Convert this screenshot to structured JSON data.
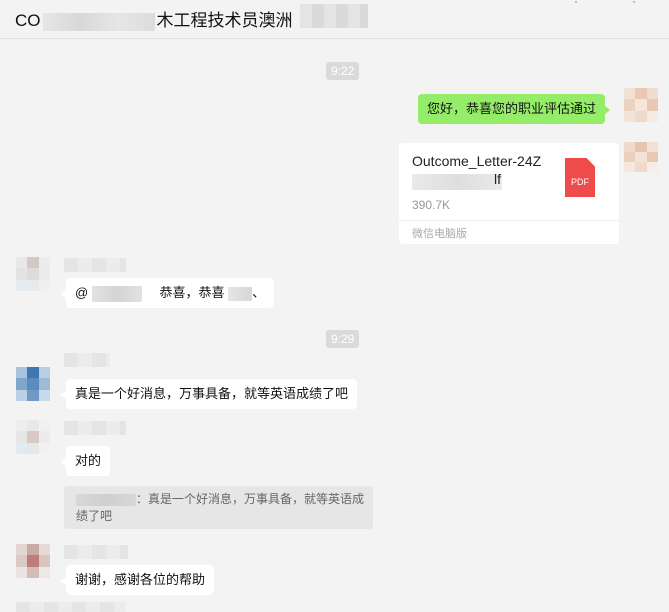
{
  "window": {
    "title_start": "CO",
    "title_end": "木工程技术员澳洲"
  },
  "timestamps": [
    "9:22",
    "9:29"
  ],
  "messages": {
    "m1": {
      "text": "您好，恭喜您的职业评估通过"
    },
    "file": {
      "name": "Outcome_Letter-24Z",
      "name_tail": "lf",
      "size": "390.7K",
      "source": "微信电脑版",
      "icon_label": "PDF"
    },
    "m2": {
      "prefix": "@",
      "text": "恭喜，恭喜",
      "suffix": "、"
    },
    "m3": {
      "text": "真是一个好消息，万事具备，就等英语成绩了吧"
    },
    "m4": {
      "text": "对的"
    },
    "quote": {
      "text": "：真是一个好消息，万事具备，就等英语成绩了吧"
    },
    "m5": {
      "text": "谢谢，感谢各位的帮助"
    }
  },
  "colors": {
    "outgoing_bubble": "#95ec69",
    "incoming_bubble": "#ffffff",
    "background": "#f3f3f3",
    "pdf_icon": "#f04b4b"
  }
}
